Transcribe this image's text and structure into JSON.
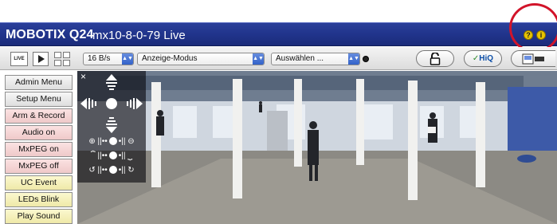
{
  "titlebar": {
    "brand": "MOBOTIX Q24",
    "camera": "mx10-8-0-79 Live",
    "icons": [
      "help-icon",
      "info-icon"
    ]
  },
  "toolbar": {
    "live_label": "LIVE",
    "framerate": "16 B/s",
    "mode": "Anzeige-Modus",
    "select": "Auswählen ...",
    "hiq_label": "HiQ",
    "accent": "#2f5fc8"
  },
  "sidebar": {
    "items": [
      {
        "label": "Admin Menu",
        "color": "gray"
      },
      {
        "label": "Setup Menu",
        "color": "gray"
      },
      {
        "label": "Arm & Record",
        "color": "pink"
      },
      {
        "label": "Audio on",
        "color": "pink"
      },
      {
        "label": "MxPEG on",
        "color": "pink"
      },
      {
        "label": "MxPEG off",
        "color": "pink"
      },
      {
        "label": "UC Event",
        "color": "yellow"
      },
      {
        "label": "LEDs Blink",
        "color": "yellow"
      },
      {
        "label": "Play Sound",
        "color": "yellow"
      }
    ]
  },
  "ptz": {
    "close": "×",
    "rows": [
      "zoom-row",
      "tilt-row",
      "pan-row"
    ]
  },
  "colors": {
    "titlebar": "#20338a",
    "annotation": "#d2142a"
  }
}
